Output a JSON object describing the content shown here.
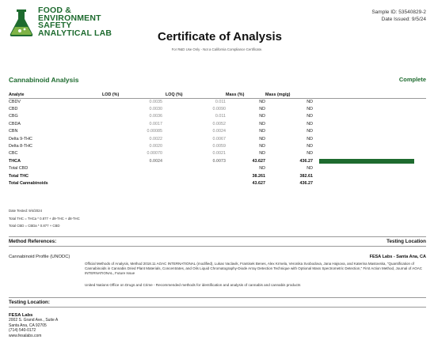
{
  "header": {
    "logo_lines": [
      "FOOD &",
      "ENVIRONMENT",
      "SAFETY",
      "ANALYTICAL LAB"
    ],
    "title": "Certificate of Analysis",
    "sample_id": "Sample ID: 53540829-2",
    "date_issued": "Date Issued: 9/5/24"
  },
  "disclaimer": "For R&D Use Only - Not a California Compliance Certificate.",
  "section": {
    "title": "Cannabinoid Analysis",
    "status": "Complete"
  },
  "table": {
    "headers": [
      "Analyte",
      "LOD (%)",
      "LOQ (%)",
      "Mass (%)",
      "Mass (mg/g)"
    ],
    "rows": [
      {
        "analyte": "CBDV",
        "lod": "0.0035",
        "loq": "0.011",
        "mass": "ND",
        "mass_mg": "ND"
      },
      {
        "analyte": "CBD",
        "lod": "0.0030",
        "loq": "0.0090",
        "mass": "ND",
        "mass_mg": "ND"
      },
      {
        "analyte": "CBG",
        "lod": "0.0036",
        "loq": "0.011",
        "mass": "ND",
        "mass_mg": "ND"
      },
      {
        "analyte": "CBDA",
        "lod": "0.0017",
        "loq": "0.0052",
        "mass": "ND",
        "mass_mg": "ND"
      },
      {
        "analyte": "CBN",
        "lod": "0.00085",
        "loq": "0.0024",
        "mass": "ND",
        "mass_mg": "ND"
      },
      {
        "analyte": "Delta 9-THC",
        "lod": "0.0022",
        "loq": "0.0067",
        "mass": "ND",
        "mass_mg": "ND"
      },
      {
        "analyte": "Delta 8-THC",
        "lod": "0.0020",
        "loq": "0.0059",
        "mass": "ND",
        "mass_mg": "ND"
      },
      {
        "analyte": "CBC",
        "lod": "0.00070",
        "loq": "0.0021",
        "mass": "ND",
        "mass_mg": "ND"
      },
      {
        "analyte": "THCA",
        "lod": "0.0024",
        "loq": "0.0073",
        "mass": "43.627",
        "mass_mg": "436.27",
        "bold": true,
        "bar_fraction": 0.92
      },
      {
        "analyte": "Total CBD",
        "lod": "",
        "loq": "",
        "mass": "ND",
        "mass_mg": "ND"
      },
      {
        "analyte": "Total THC",
        "lod": "",
        "loq": "",
        "mass": "38.261",
        "mass_mg": "382.61",
        "bold": true
      },
      {
        "analyte": "Total Cannabinoids",
        "lod": "",
        "loq": "",
        "mass": "43.627",
        "mass_mg": "436.27",
        "bold": true
      }
    ],
    "bar_color": "#1e6b2f"
  },
  "formulas": {
    "date_tested": "Date Tested: 9/4/2024",
    "total_thc": "Total THC = THCa * 0.877 + d9-THC + d8-THC",
    "total_cbd": "Total CBD = CBDa * 0.877 + CBD"
  },
  "methods": {
    "label": "Method References:",
    "testing_location_label": "Testing Location",
    "profile_name": "Cannabinoid Profile (UNODC)",
    "lab_location": "FESA Labs - Santa Ana, CA",
    "reference_text": "Official Methods of Analysis, Method 2018.11 AOAC INTERNATIONAL (modified), Lukas Vaclavik, Frantisek Benes, Alex Krmela, Veronika Svobodova, Jana Hajsova, and Katerina Mastovska, \"Quantification of Cannabinoids in Cannabis Dried Plant Materials, Concentrates, and Oils Liquid Chromatography-Diode Array Detection Technique with Optional Mass Spectrometric Detection,\" First Action Method, Journal of AOAC INTERNATIONAL, Future Issue",
    "un_reference": "United Nations Office on Drugs and Crime - Recommended methods for identification and analysis of cannabis and cannabis products"
  },
  "testing_location": {
    "label": "Testing Location:",
    "name": "FESA Labs",
    "address1": "2002 S. Grand Ave., Suite A",
    "address2": "Santa Ana, CA 92705",
    "phone": "(714) 540-0172",
    "website": "www.fesalabs.com"
  },
  "colors": {
    "accent": "#1e6b2f"
  }
}
